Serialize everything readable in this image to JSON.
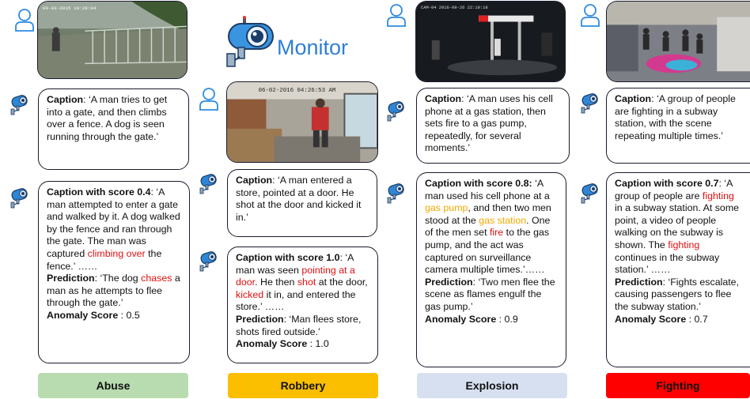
{
  "logo": {
    "title": "Monitor",
    "icon": "security-camera-icon"
  },
  "columns": [
    {
      "category": "Abuse",
      "label_color": "#b8dcb0",
      "label_text_color": "#111111",
      "caption_label": "Caption",
      "caption_text": ": ‘A man tries to get into a gate, and then climbs over a fence. A dog is seen running through the gate.’",
      "scored_label": "Caption with score 0.4",
      "scored_pre": ": ‘A man attempted to enter a gate and walked by it. A dog walked by the fence and ran through the gate. The man was captured ",
      "scored_hl1": "climbing over",
      "scored_post": " the fence.’ ……",
      "prediction_label": "Prediction",
      "prediction_pre": ": ‘The dog ",
      "prediction_hl": "chases",
      "prediction_post": " a man as he attempts to flee through the gate.’",
      "anomaly_label": "Anomaly Score",
      "anomaly_value": " : 0.5",
      "image_alt": "gate"
    },
    {
      "category": "Robbery",
      "label_color": "#fbbf00",
      "label_text_color": "#111111",
      "caption_label": "Caption",
      "caption_text": ": ‘A man entered a store, pointed at a door. He shot at the door and kicked it in.’",
      "scored_label": "Caption with score 1.0",
      "scored_pre": ": ‘A man was seen ",
      "scored_hl1": "pointing at a door",
      "scored_mid": ". He then ",
      "scored_hl2": "shot",
      "scored_mid2": " at the door, ",
      "scored_hl3": "kicked",
      "scored_post": " it in, and entered the store.’ ……",
      "prediction_label": "Prediction",
      "prediction_text": ": ‘Man flees store, shots fired outside.’",
      "anomaly_label": "Anomaly Score",
      "anomaly_value": " : 1.0",
      "image_timestamp": "06-02-2016 04:26:53 AM"
    },
    {
      "category": "Explosion",
      "label_color": "#d6e0f0",
      "label_text_color": "#111111",
      "caption_label": "Caption",
      "caption_text": ": ‘A man uses his cell phone at a gas station, then sets fire to a gas pump, repeatedly, for several moments.’",
      "scored_label": "Caption with score 0.8:",
      "scored_pre": " ‘A man used his cell phone at a ",
      "scored_hl1": "gas pump",
      "scored_mid": ", and then two men stood at the ",
      "scored_hl2": "gas station",
      "scored_mid2": ". One of the men set ",
      "scored_hl3": "fire",
      "scored_post": " to the gas pump, and the act was captured on surveillance camera multiple times.’……",
      "prediction_label": "Prediction",
      "prediction_text": ": ‘Two men flee the scene as flames engulf the gas pump.’",
      "anomaly_label": "Anomaly Score",
      "anomaly_value": " : 0.9"
    },
    {
      "category": "Fighting",
      "label_color": "#ff0000",
      "label_text_color": "#111111",
      "caption_label": "Caption",
      "caption_text": ": ‘A group of people are fighting in a subway station, with the scene repeating multiple times.’",
      "scored_label": "Caption with score 0.7",
      "scored_pre": ": ‘A group of people are ",
      "scored_hl1": "fighting",
      "scored_mid": " in a subway station. At some point, a video of people walking on the subway is shown. The ",
      "scored_hl2": "fighting",
      "scored_post": " continues in the subway station.’ ……",
      "prediction_label": "Prediction",
      "prediction_text": ": ‘Fights escalate, causing passengers to flee the subway station.’",
      "anomaly_label": "Anomaly Score",
      "anomaly_value": " : 0.7"
    }
  ]
}
